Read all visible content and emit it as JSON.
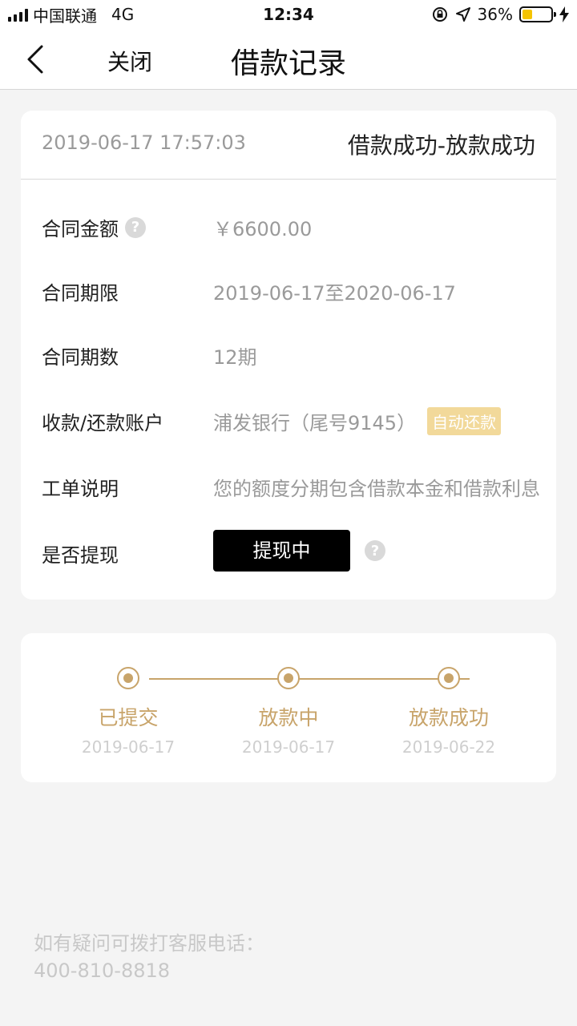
{
  "status_bar": {
    "carrier": "中国联通",
    "network": "4G",
    "time": "12:34",
    "battery": "36%",
    "battery_level": 0.36
  },
  "nav": {
    "close_label": "关闭",
    "title": "借款记录"
  },
  "record": {
    "datetime": "2019-06-17 17:57:03",
    "status": "借款成功-放款成功",
    "rows": [
      {
        "label": "合同金额",
        "value": "￥6600.00"
      },
      {
        "label": "合同期限",
        "value": "2019-06-17至2020-06-17"
      },
      {
        "label": "合同期数",
        "value": "12期"
      },
      {
        "label": "收款/还款账户",
        "value": "浦发银行（尾号9145）",
        "badge": "自动还款"
      },
      {
        "label": "工单说明",
        "value": "您的额度分期包含借款本金和借款利息"
      },
      {
        "label": "是否提现",
        "button": "提现中"
      }
    ]
  },
  "progress": {
    "steps": [
      {
        "label": "已提交",
        "date": "2019-06-17"
      },
      {
        "label": "放款中",
        "date": "2019-06-17"
      },
      {
        "label": "放款成功",
        "date": "2019-06-22"
      }
    ]
  },
  "footer": {
    "hotline_label": "如有疑问可拨打客服电话：",
    "hotline_number": "400-810-8818"
  },
  "colors": {
    "accent_gold": "#c8a46a",
    "badge_bg": "#f2d99a",
    "battery_yellow": "#f5c400"
  },
  "icons": {
    "back": "chevron-left-icon",
    "help": "question-circle-icon",
    "signal": "signal-icon",
    "lock_rotation": "rotation-lock-icon",
    "location": "location-arrow-icon",
    "battery": "battery-icon",
    "charging": "bolt-icon"
  }
}
